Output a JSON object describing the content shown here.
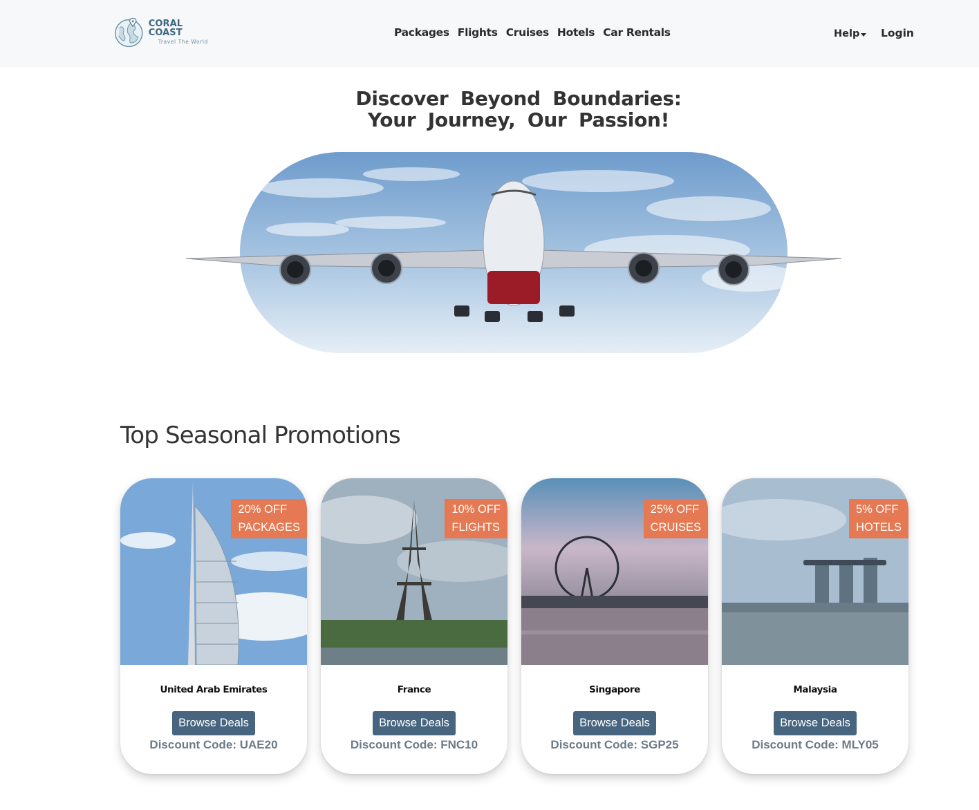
{
  "brand": {
    "name": "CORAL COAST",
    "tagline": "Travel The World",
    "accent": "#3d6783"
  },
  "nav": {
    "items": [
      "Packages",
      "Flights",
      "Cruises",
      "Hotels",
      "Car Rentals"
    ],
    "help": "Help",
    "login": "Login"
  },
  "hero": {
    "line1": "Discover Beyond Boundaries:",
    "line2": "Your Journey, Our Passion!"
  },
  "promotions": {
    "title": "Top Seasonal Promotions",
    "button_label": "Browse Deals",
    "badge_color": "#e57953",
    "button_color": "#47657f",
    "cards": [
      {
        "badge_line1": "20% OFF",
        "badge_line2": "PACKAGES",
        "country": "United Arab Emirates",
        "code": "Discount Code: UAE20"
      },
      {
        "badge_line1": "10% OFF",
        "badge_line2": "FLIGHTS",
        "country": "France",
        "code": "Discount Code: FNC10"
      },
      {
        "badge_line1": "25% OFF",
        "badge_line2": "CRUISES",
        "country": "Singapore",
        "code": "Discount Code: SGP25"
      },
      {
        "badge_line1": "5% OFF",
        "badge_line2": "HOTELS",
        "country": "Malaysia",
        "code": "Discount Code: MLY05"
      }
    ]
  }
}
